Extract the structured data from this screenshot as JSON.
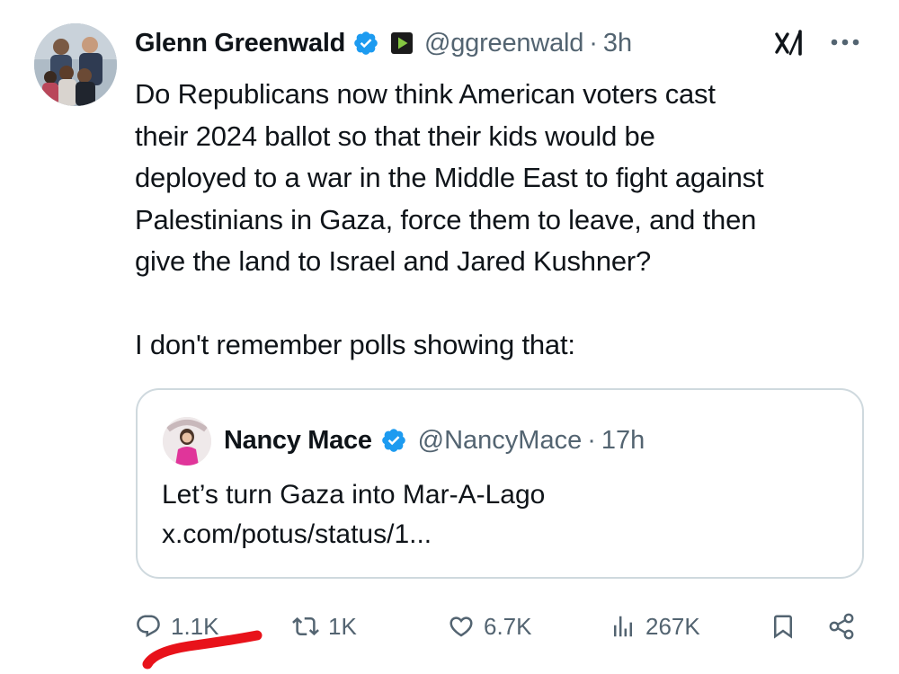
{
  "post": {
    "author_name": "Glenn Greenwald",
    "handle": "@ggreenwald",
    "separator": "·",
    "time": "3h",
    "text": "Do Republicans now think American voters cast\ntheir 2024 ballot so that their kids would be\ndeployed to a war in the Middle East to fight against\nPalestinians in Gaza, force them to leave, and then\ngive the land to Israel and Jared Kushner?\n\nI don't remember polls showing that:"
  },
  "quote": {
    "author_name": "Nancy Mace",
    "handle": "@NancyMace",
    "separator": "·",
    "time": "17h",
    "text": "Let’s turn Gaza into Mar-A-Lago\nx.com/potus/status/1..."
  },
  "actions": {
    "replies": "1.1K",
    "reposts": "1K",
    "likes": "6.7K",
    "views": "267K"
  },
  "icons": {
    "verified": "verified-badge-icon",
    "affiliate": "rumble-play-icon",
    "grok": "grok-icon",
    "more": "more-icon",
    "reply": "reply-icon",
    "repost": "repost-icon",
    "like": "heart-icon",
    "views": "views-icon",
    "bookmark": "bookmark-icon",
    "share": "share-icon"
  },
  "colors": {
    "verified_blue": "#1d9bf0",
    "secondary_text": "#536471",
    "annotation_red": "#e8121a",
    "border": "#cfd9de"
  }
}
